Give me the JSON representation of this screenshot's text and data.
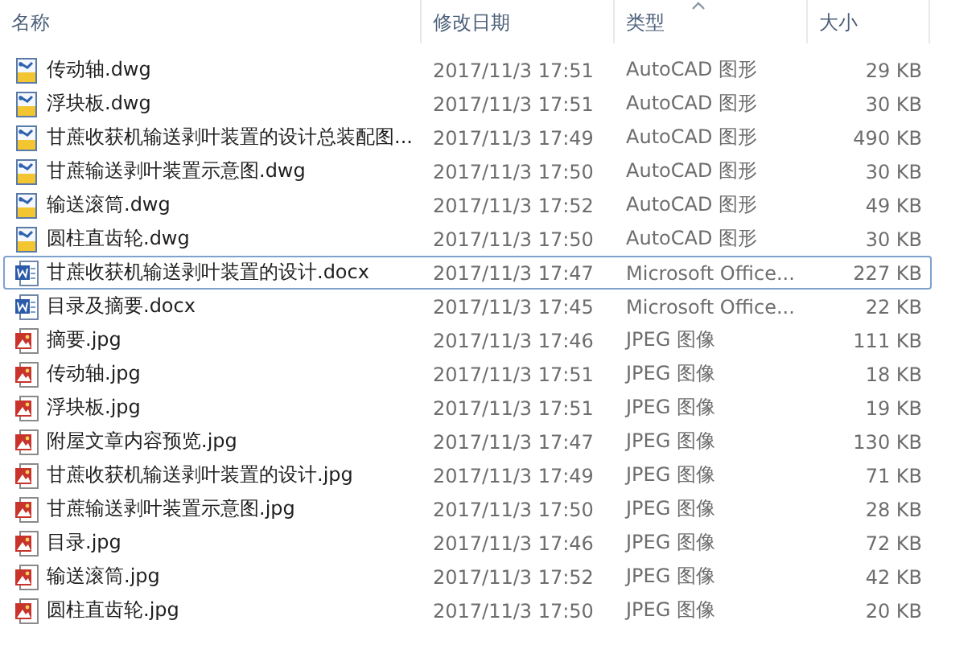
{
  "columns": [
    {
      "label": "名称",
      "sorted": false
    },
    {
      "label": "修改日期",
      "sorted": false
    },
    {
      "label": "类型",
      "sorted": true
    },
    {
      "label": "大小",
      "sorted": false
    }
  ],
  "rows": [
    {
      "kind": "dwg",
      "name": "传动轴.dwg",
      "date": "2017/11/3 17:51",
      "type": "AutoCAD 图形",
      "size": "29 KB",
      "focused": false
    },
    {
      "kind": "dwg",
      "name": "浮块板.dwg",
      "date": "2017/11/3 17:51",
      "type": "AutoCAD 图形",
      "size": "30 KB",
      "focused": false
    },
    {
      "kind": "dwg",
      "name": "甘蔗收获机输送剥叶装置的设计总装配图...",
      "date": "2017/11/3 17:49",
      "type": "AutoCAD 图形",
      "size": "490 KB",
      "focused": false
    },
    {
      "kind": "dwg",
      "name": "甘蔗输送剥叶装置示意图.dwg",
      "date": "2017/11/3 17:50",
      "type": "AutoCAD 图形",
      "size": "30 KB",
      "focused": false
    },
    {
      "kind": "dwg",
      "name": "输送滚筒.dwg",
      "date": "2017/11/3 17:52",
      "type": "AutoCAD 图形",
      "size": "49 KB",
      "focused": false
    },
    {
      "kind": "dwg",
      "name": "圆柱直齿轮.dwg",
      "date": "2017/11/3 17:50",
      "type": "AutoCAD 图形",
      "size": "30 KB",
      "focused": false
    },
    {
      "kind": "docx",
      "name": "甘蔗收获机输送剥叶装置的设计.docx",
      "date": "2017/11/3 17:47",
      "type": "Microsoft Office...",
      "size": "227 KB",
      "focused": true
    },
    {
      "kind": "docx",
      "name": "目录及摘要.docx",
      "date": "2017/11/3 17:45",
      "type": "Microsoft Office...",
      "size": "22 KB",
      "focused": false
    },
    {
      "kind": "jpg",
      "name": "摘要.jpg",
      "date": "2017/11/3 17:46",
      "type": "JPEG 图像",
      "size": "111 KB",
      "focused": false
    },
    {
      "kind": "jpg",
      "name": "传动轴.jpg",
      "date": "2017/11/3 17:51",
      "type": "JPEG 图像",
      "size": "18 KB",
      "focused": false
    },
    {
      "kind": "jpg",
      "name": "浮块板.jpg",
      "date": "2017/11/3 17:51",
      "type": "JPEG 图像",
      "size": "19 KB",
      "focused": false
    },
    {
      "kind": "jpg",
      "name": "附屋文章内容预览.jpg",
      "date": "2017/11/3 17:47",
      "type": "JPEG 图像",
      "size": "130 KB",
      "focused": false
    },
    {
      "kind": "jpg",
      "name": "甘蔗收获机输送剥叶装置的设计.jpg",
      "date": "2017/11/3 17:49",
      "type": "JPEG 图像",
      "size": "71 KB",
      "focused": false
    },
    {
      "kind": "jpg",
      "name": "甘蔗输送剥叶装置示意图.jpg",
      "date": "2017/11/3 17:50",
      "type": "JPEG 图像",
      "size": "28 KB",
      "focused": false
    },
    {
      "kind": "jpg",
      "name": "目录.jpg",
      "date": "2017/11/3 17:46",
      "type": "JPEG 图像",
      "size": "72 KB",
      "focused": false
    },
    {
      "kind": "jpg",
      "name": "输送滚筒.jpg",
      "date": "2017/11/3 17:52",
      "type": "JPEG 图像",
      "size": "42 KB",
      "focused": false
    },
    {
      "kind": "jpg",
      "name": "圆柱直齿轮.jpg",
      "date": "2017/11/3 17:50",
      "type": "JPEG 图像",
      "size": "20 KB",
      "focused": false
    }
  ]
}
